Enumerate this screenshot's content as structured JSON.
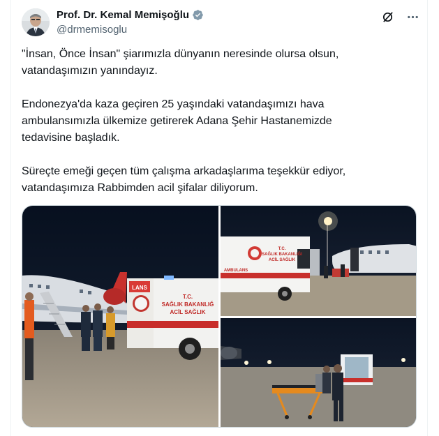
{
  "author": {
    "display_name": "Prof. Dr. Kemal Memişoğlu",
    "handle": "@drmemisoglu",
    "verified_color": "#829aab"
  },
  "header_actions": {
    "grok_icon": "slashed-circle-icon",
    "more_icon": "more-dots-icon"
  },
  "tweet": {
    "paragraphs": [
      "\"İnsan, Önce İnsan\" şiarımızla dünyanın neresinde olursa olsun,\nvatandaşımızın yanındayız.",
      "Endonezya'da kaza geçiren 25 yaşındaki vatandaşımızı hava\nambulansımızla ülkemize getirerek Adana Şehir Hastanemizde\ntedavisine başladık.",
      "Süreçte emeği geçen tüm çalışma arkadaşlarıma teşekkür ediyor,\nvatandaşımıza Rabbimden acil şifalar diliyorum."
    ]
  },
  "media": {
    "left_image": {
      "ambulance_text_1": "T.C.",
      "ambulance_text_2": "SAĞLIK BAKANLIĞ",
      "ambulance_text_3": "ACİL SAĞLIK",
      "ambulance_text_front": "LANS"
    },
    "top_right_image": {
      "ambulance_text_1": "T.C.",
      "ambulance_text_2": "SAĞLIK BAKANLIĞI",
      "ambulance_text_3": "ACİL SAĞLIK",
      "ambulance_text_side": "AMBULANS"
    },
    "bottom_right_image": {}
  },
  "colors": {
    "text": "#0f1419",
    "muted": "#536471",
    "border": "#cfd9de"
  }
}
